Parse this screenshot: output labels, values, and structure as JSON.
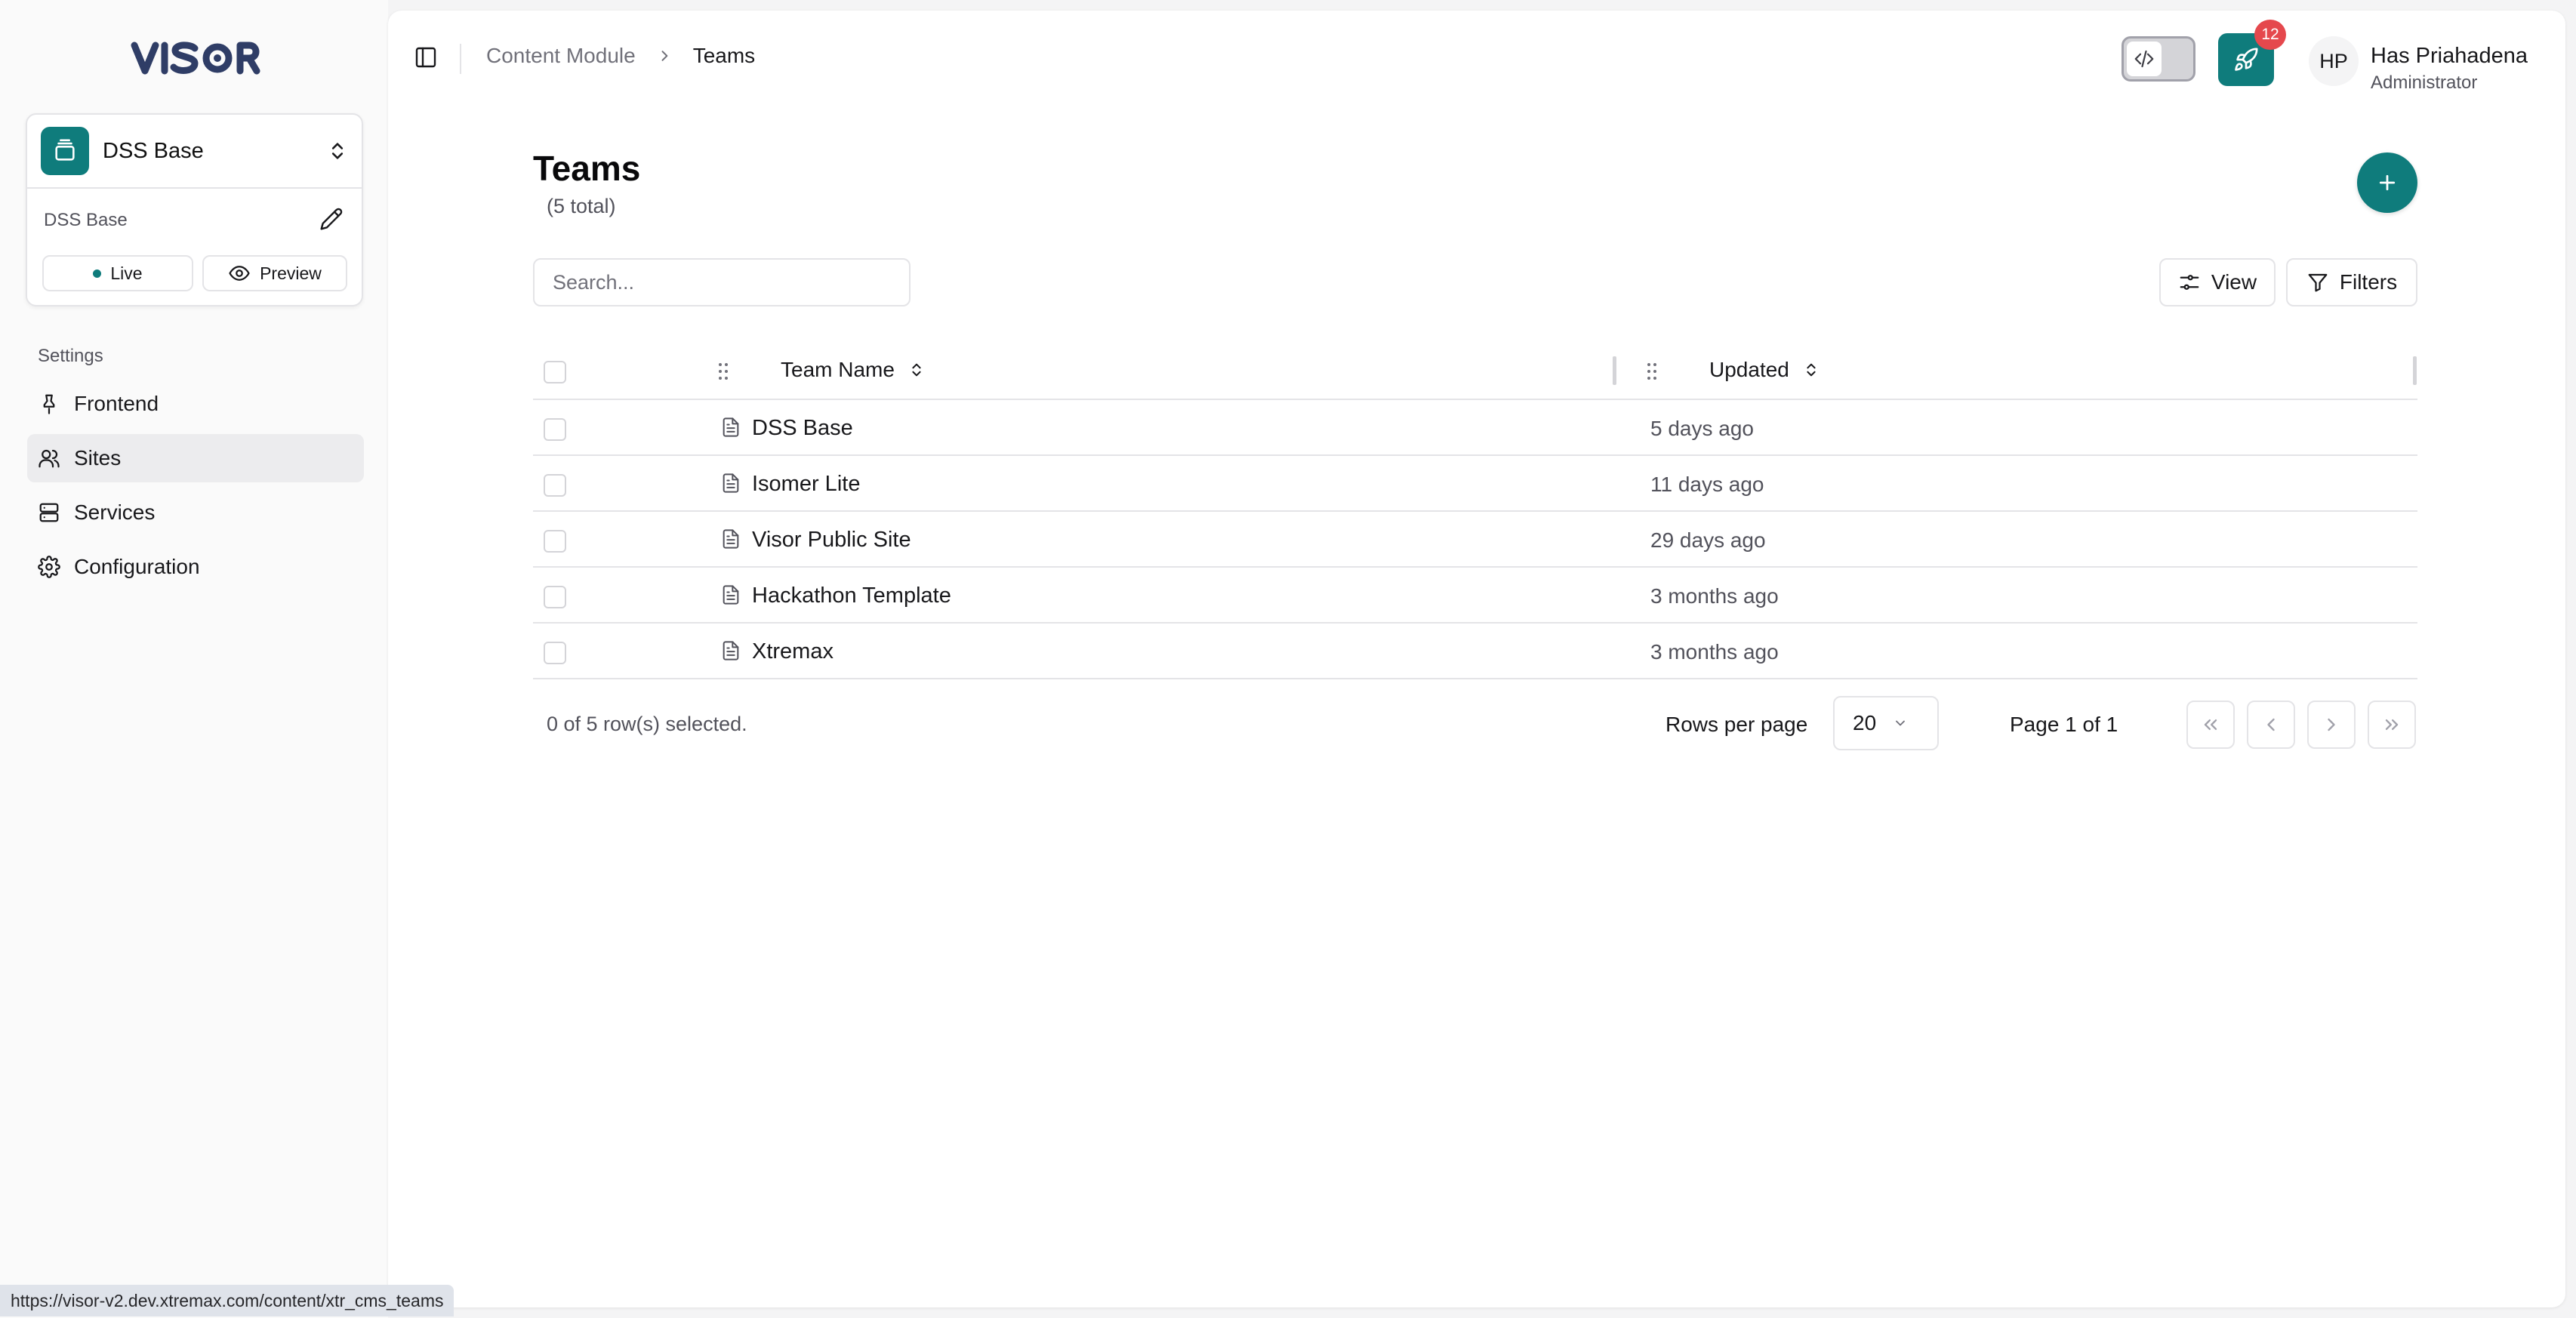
{
  "app": {
    "logo_text": "VISOR"
  },
  "site": {
    "name": "DSS Base",
    "subtitle": "DSS Base",
    "live_label": "Live",
    "preview_label": "Preview"
  },
  "sidebar": {
    "section_label": "Settings",
    "items": [
      {
        "label": "Frontend",
        "icon": "pin-icon"
      },
      {
        "label": "Sites",
        "icon": "users-icon",
        "active": true
      },
      {
        "label": "Services",
        "icon": "server-icon"
      },
      {
        "label": "Configuration",
        "icon": "gear-icon"
      }
    ]
  },
  "breadcrumb": {
    "parent": "Content Module",
    "current": "Teams"
  },
  "header": {
    "notification_count": "12",
    "user_initials": "HP",
    "user_name": "Has Priahadena",
    "user_role": "Administrator"
  },
  "page": {
    "title": "Teams",
    "count": "(5 total)"
  },
  "toolbar": {
    "search_placeholder": "Search...",
    "view_label": "View",
    "filters_label": "Filters"
  },
  "table": {
    "columns": [
      "Team Name",
      "Updated"
    ],
    "rows": [
      {
        "name": "DSS Base",
        "updated": "5 days ago"
      },
      {
        "name": "Isomer Lite",
        "updated": "11 days ago"
      },
      {
        "name": "Visor Public Site",
        "updated": "29 days ago"
      },
      {
        "name": "Hackathon Template",
        "updated": "3 months ago"
      },
      {
        "name": "Xtremax",
        "updated": "3 months ago"
      }
    ]
  },
  "pagination": {
    "selected_text": "0 of 5 row(s) selected.",
    "rows_per_page_label": "Rows per page",
    "rows_per_page_value": "20",
    "page_text": "Page 1 of 1"
  },
  "status_bar": {
    "url": "https://visor-v2.dev.xtremax.com/content/xtr_cms_teams"
  },
  "colors": {
    "accent": "#0f7c7c",
    "badge": "#e5484d",
    "logo": "#2f3d66"
  }
}
